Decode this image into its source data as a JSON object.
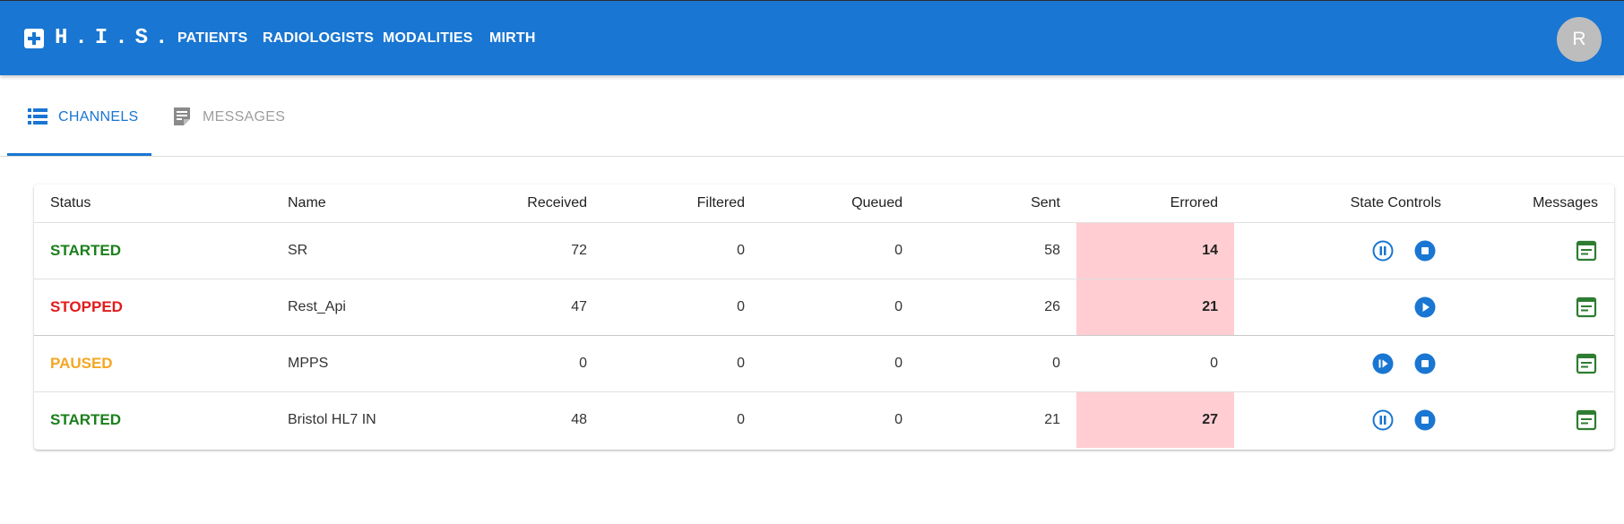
{
  "header": {
    "brand": "H.I.S.",
    "nav": [
      "PATIENTS",
      "RADIOLOGISTS",
      "MODALITIES",
      "MIRTH"
    ],
    "avatar_initial": "R",
    "color": "#1976d2"
  },
  "tabs": [
    {
      "label": "CHANNELS",
      "icon": "list-icon",
      "active": true
    },
    {
      "label": "MESSAGES",
      "icon": "note-icon",
      "active": false
    }
  ],
  "table": {
    "columns": [
      "Status",
      "Name",
      "Received",
      "Filtered",
      "Queued",
      "Sent",
      "Errored",
      "State Controls",
      "Messages"
    ],
    "rows": [
      {
        "status": "STARTED",
        "status_color": "#1b7f1b",
        "name": "SR",
        "received": "72",
        "filtered": "0",
        "queued": "0",
        "sent": "58",
        "errored": "14",
        "errored_highlight": true,
        "controls": [
          "pause-icon",
          "stop-icon"
        ]
      },
      {
        "status": "STOPPED",
        "status_color": "#e31b1b",
        "name": "Rest_Api",
        "received": "47",
        "filtered": "0",
        "queued": "0",
        "sent": "26",
        "errored": "21",
        "errored_highlight": true,
        "controls": [
          "play-icon"
        ]
      },
      {
        "status": "PAUSED",
        "status_color": "#f5a623",
        "name": "MPPS",
        "received": "0",
        "filtered": "0",
        "queued": "0",
        "sent": "0",
        "errored": "0",
        "errored_highlight": false,
        "controls": [
          "resume-icon",
          "stop-icon"
        ]
      },
      {
        "status": "STARTED",
        "status_color": "#1b7f1b",
        "name": "Bristol HL7 IN",
        "received": "48",
        "filtered": "0",
        "queued": "0",
        "sent": "21",
        "errored": "27",
        "errored_highlight": true,
        "controls": [
          "pause-icon",
          "stop-icon"
        ]
      }
    ]
  },
  "colors": {
    "accent": "#1976d2",
    "error_highlight": "#ffcdd2",
    "message_icon": "#2e7d32"
  }
}
